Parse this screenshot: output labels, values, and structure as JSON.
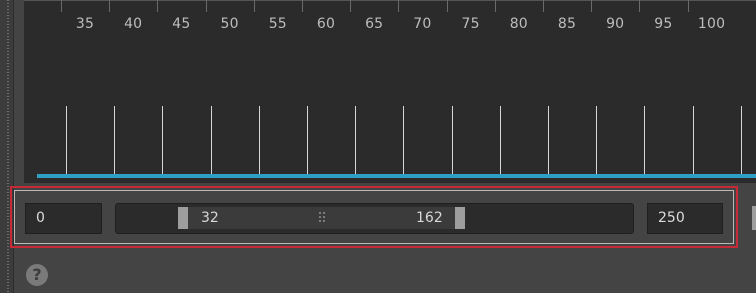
{
  "timeline": {
    "ruler_labels": [
      "35",
      "40",
      "45",
      "50",
      "55",
      "60",
      "65",
      "70",
      "75",
      "80",
      "85",
      "90",
      "95",
      "100"
    ],
    "highlight_color": "#2f9fc4"
  },
  "range_slider": {
    "min_value": "0",
    "max_value": "250",
    "range_start": "32",
    "range_end": "162",
    "grip_icon": "drag-grip-icon"
  },
  "help": {
    "icon": "help-icon",
    "label": "?"
  },
  "colors": {
    "background": "#444444",
    "timeline_bg": "#2b2b2b",
    "selection_frame": "#c72a36"
  }
}
